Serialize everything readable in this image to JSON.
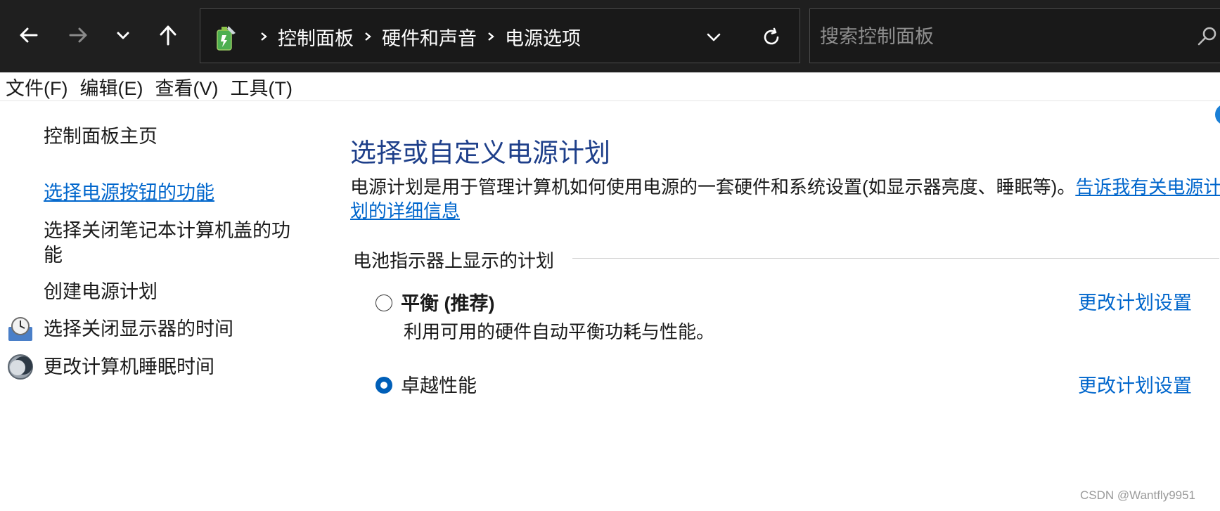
{
  "nav": {
    "back": "back-arrow",
    "forward": "forward-arrow",
    "recent": "chevron-down",
    "up": "up-arrow"
  },
  "address": {
    "crumbs": [
      "控制面板",
      "硬件和声音",
      "电源选项"
    ]
  },
  "search": {
    "placeholder": "搜索控制面板"
  },
  "menu": [
    "文件(F)",
    "编辑(E)",
    "查看(V)",
    "工具(T)"
  ],
  "sidebar": {
    "home": "控制面板主页",
    "links": [
      "选择电源按钮的功能",
      "选择关闭笔记本计算机盖的功能",
      "创建电源计划",
      "选择关闭显示器的时间",
      "更改计算机睡眠时间"
    ]
  },
  "main": {
    "title": "选择或自定义电源计划",
    "desc": "电源计划是用于管理计算机如何使用电源的一套硬件和系统设置(如显示器亮度、睡眠等)。",
    "desc_link": "告诉我有关电源计划的详细信息",
    "group_label": "电池指示器上显示的计划",
    "plans": [
      {
        "name": "平衡 (推荐)",
        "desc": "利用可用的硬件自动平衡功耗与性能。",
        "link": "更改计划设置",
        "selected": false
      },
      {
        "name": "卓越性能",
        "desc": "",
        "link": "更改计划设置",
        "selected": true
      }
    ]
  },
  "watermark": "CSDN @Wantfly9951",
  "colors": {
    "link": "#0066cc",
    "title": "#1e3f8a",
    "topbar": "#1f1f1f",
    "radio_on": "#005fb8"
  }
}
